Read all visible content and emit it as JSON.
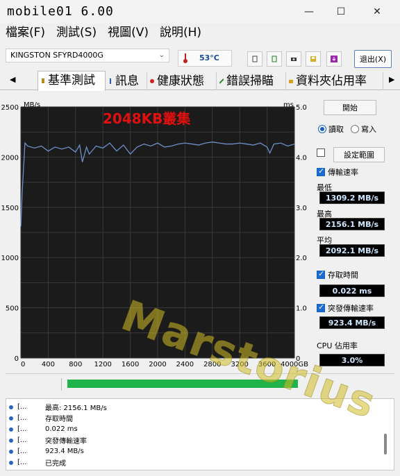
{
  "window": {
    "title_prefix": "mobile01 ",
    "title_version": "6.00",
    "minimize": "—",
    "maximize": "☐",
    "close": "✕"
  },
  "menu": [
    {
      "label": "檔案(F)"
    },
    {
      "label": "測試(S)"
    },
    {
      "label": "視圖(V)"
    },
    {
      "label": "說明(H)"
    }
  ],
  "toolbar": {
    "drive": "KINGSTON SFYRD4000G",
    "temperature": "53°C",
    "exit_label": "退出(X)"
  },
  "tabs": [
    {
      "label": "基準測試",
      "active": true
    },
    {
      "label": "訊息"
    },
    {
      "label": "健康狀態"
    },
    {
      "label": "錯誤掃瞄"
    },
    {
      "label": "資料夾佔用率"
    }
  ],
  "chart_data": {
    "type": "line",
    "title": "2048KB叢集",
    "y_left_unit": "MB/s",
    "y_right_unit": "ms",
    "y_left_ticks": [
      "2500",
      "2000",
      "1500",
      "1000",
      "500",
      "0"
    ],
    "y_right_ticks": [
      "5.0",
      "4.0",
      "3.0",
      "2.0",
      "1.0",
      "0"
    ],
    "ylim_left": [
      0,
      2500
    ],
    "ylim_right": [
      0,
      5
    ],
    "x_ticks": [
      "0",
      "400",
      "800",
      "1200",
      "1600",
      "2000",
      "2400",
      "2800",
      "3200",
      "3600",
      "4000GB"
    ],
    "xlim": [
      0,
      4000
    ],
    "grid": true,
    "series": [
      {
        "x": [
          0,
          20,
          60,
          100,
          200,
          300,
          400,
          500,
          600,
          700,
          800,
          860,
          900,
          960,
          1000,
          1100,
          1200,
          1300,
          1400,
          1500,
          1600,
          1700,
          1800,
          1900,
          2000,
          2100,
          2200,
          2300,
          2400,
          2500,
          2600,
          2700,
          2800,
          2900,
          3000,
          3100,
          3200,
          3300,
          3400,
          3500,
          3600,
          3640,
          3700,
          3800,
          3900,
          4000
        ],
        "values": [
          1309,
          1650,
          2140,
          2110,
          2090,
          2110,
          2060,
          2100,
          2080,
          2100,
          2050,
          2120,
          1950,
          2100,
          2030,
          2110,
          2090,
          2140,
          2060,
          2120,
          2030,
          2100,
          2130,
          2110,
          2140,
          2100,
          2110,
          2130,
          2140,
          2130,
          2120,
          2140,
          2150,
          2140,
          2130,
          2130,
          2140,
          2130,
          2120,
          2140,
          2100,
          2040,
          2130,
          2140,
          2110,
          2130
        ]
      }
    ]
  },
  "panel": {
    "start_label": "開始",
    "read_label": "讀取",
    "write_label": "寫入",
    "range_label": "設定範圍",
    "transfer_label": "傳輸速率",
    "min_label": "最低",
    "min_value": "1309.2 MB/s",
    "max_label": "最高",
    "max_value": "2156.1 MB/s",
    "avg_label": "平均",
    "avg_value": "2092.1 MB/s",
    "access_label": "存取時間",
    "access_value": "0.022 ms",
    "burst_label": "突發傳輸速率",
    "burst_value": "923.4 MB/s",
    "cpu_label": "CPU 佔用率",
    "cpu_value": "3.0%"
  },
  "progress": {
    "value": 1.0,
    "color": "#1fb34a"
  },
  "log": [
    {
      "prefix": "[...",
      "text": "最高: 2156.1 MB/s"
    },
    {
      "prefix": "[...",
      "text": "存取時間"
    },
    {
      "prefix": "[...",
      "text": "0.022 ms"
    },
    {
      "prefix": "[...",
      "text": "突發傳輸速率"
    },
    {
      "prefix": "[...",
      "text": "923.4 MB/s"
    },
    {
      "prefix": "[...",
      "text": "已完成"
    }
  ],
  "watermark": "Marstorius",
  "colors": {
    "chart_bg": "#1b1b1b",
    "grid": "#3a3a3a",
    "line": "#6f8fc9",
    "title": "#e01010",
    "stat_text": "#cfe8ff"
  }
}
